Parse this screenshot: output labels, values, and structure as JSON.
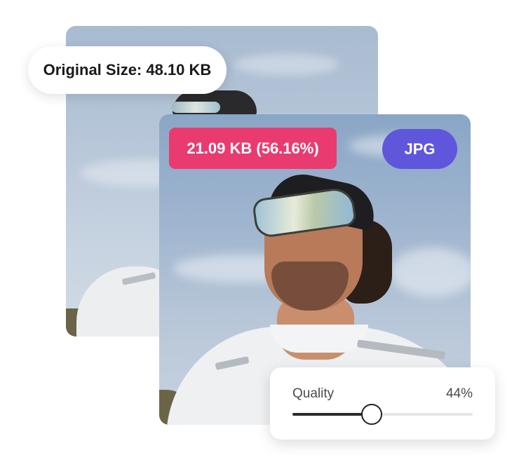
{
  "original": {
    "label": "Original Size: 48.10 KB"
  },
  "compressed": {
    "size_label": "21.09 KB (56.16%)",
    "format": "JPG"
  },
  "quality": {
    "label": "Quality",
    "value_label": "44%",
    "value": 0.44
  },
  "colors": {
    "size_badge": "#e93b6f",
    "format_badge": "#5f56dc"
  }
}
